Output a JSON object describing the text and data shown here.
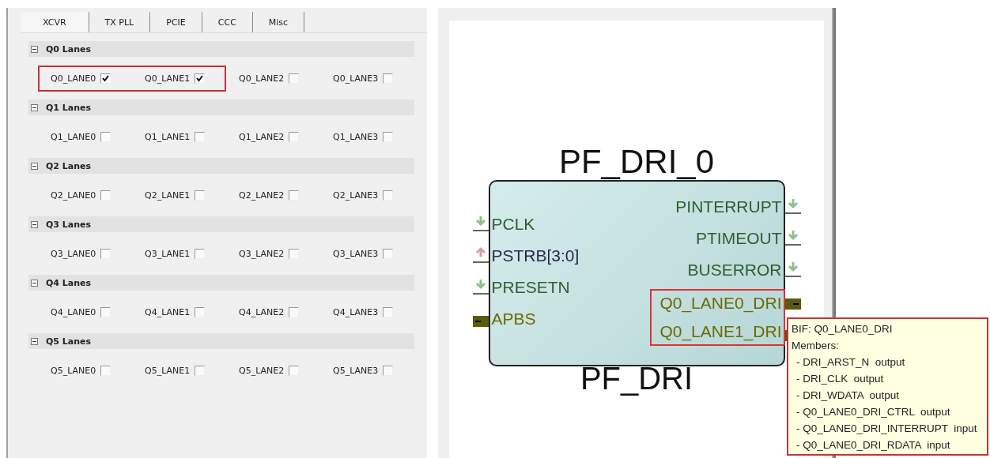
{
  "tabs": [
    {
      "label": "XCVR",
      "selected": true
    },
    {
      "label": "TX PLL",
      "selected": false
    },
    {
      "label": "PCIE",
      "selected": false
    },
    {
      "label": "CCC",
      "selected": false
    },
    {
      "label": "Misc",
      "selected": false
    }
  ],
  "sections": [
    {
      "title": "Q0 Lanes",
      "expanded": true,
      "lanes": [
        {
          "label": "Q0_LANE0",
          "checked": true,
          "highlighted": true
        },
        {
          "label": "Q0_LANE1",
          "checked": true,
          "highlighted": true
        },
        {
          "label": "Q0_LANE2",
          "checked": false,
          "highlighted": false
        },
        {
          "label": "Q0_LANE3",
          "checked": false,
          "highlighted": false
        }
      ]
    },
    {
      "title": "Q1 Lanes",
      "expanded": true,
      "lanes": [
        {
          "label": "Q1_LANE0",
          "checked": false,
          "highlighted": false
        },
        {
          "label": "Q1_LANE1",
          "checked": false,
          "highlighted": false
        },
        {
          "label": "Q1_LANE2",
          "checked": false,
          "highlighted": false
        },
        {
          "label": "Q1_LANE3",
          "checked": false,
          "highlighted": false
        }
      ]
    },
    {
      "title": "Q2 Lanes",
      "expanded": true,
      "lanes": [
        {
          "label": "Q2_LANE0",
          "checked": false,
          "highlighted": false
        },
        {
          "label": "Q2_LANE1",
          "checked": false,
          "highlighted": false
        },
        {
          "label": "Q2_LANE2",
          "checked": false,
          "highlighted": false
        },
        {
          "label": "Q2_LANE3",
          "checked": false,
          "highlighted": false
        }
      ]
    },
    {
      "title": "Q3 Lanes",
      "expanded": true,
      "lanes": [
        {
          "label": "Q3_LANE0",
          "checked": false,
          "highlighted": false
        },
        {
          "label": "Q3_LANE1",
          "checked": false,
          "highlighted": false
        },
        {
          "label": "Q3_LANE2",
          "checked": false,
          "highlighted": false
        },
        {
          "label": "Q3_LANE3",
          "checked": false,
          "highlighted": false
        }
      ]
    },
    {
      "title": "Q4 Lanes",
      "expanded": true,
      "lanes": [
        {
          "label": "Q4_LANE0",
          "checked": false,
          "highlighted": false
        },
        {
          "label": "Q4_LANE1",
          "checked": false,
          "highlighted": false
        },
        {
          "label": "Q4_LANE2",
          "checked": false,
          "highlighted": false
        },
        {
          "label": "Q4_LANE3",
          "checked": false,
          "highlighted": false
        }
      ]
    },
    {
      "title": "Q5 Lanes",
      "expanded": true,
      "lanes": [
        {
          "label": "Q5_LANE0",
          "checked": false,
          "highlighted": false
        },
        {
          "label": "Q5_LANE1",
          "checked": false,
          "highlighted": false
        },
        {
          "label": "Q5_LANE2",
          "checked": false,
          "highlighted": false
        },
        {
          "label": "Q5_LANE3",
          "checked": false,
          "highlighted": false
        }
      ]
    }
  ],
  "block": {
    "instance_name": "PF_DRI_0",
    "type_name": "PF_DRI",
    "left_ports": [
      {
        "name": "PCLK",
        "kind": "input",
        "highlighted": false
      },
      {
        "name": "PSTRB[3:0]",
        "kind": "output",
        "highlighted": false
      },
      {
        "name": "PRESETN",
        "kind": "input",
        "highlighted": false
      },
      {
        "name": "APBS",
        "kind": "bus",
        "highlighted": false
      }
    ],
    "right_ports": [
      {
        "name": "PINTERRUPT",
        "kind": "input",
        "highlighted": false
      },
      {
        "name": "PTIMEOUT",
        "kind": "input",
        "highlighted": false
      },
      {
        "name": "BUSERROR",
        "kind": "input",
        "highlighted": false
      },
      {
        "name": "Q0_LANE0_DRI",
        "kind": "bus",
        "highlighted": true
      },
      {
        "name": "Q0_LANE1_DRI",
        "kind": "bus",
        "highlighted": true
      }
    ]
  },
  "tooltip": {
    "title": "BIF: Q0_LANE0_DRI",
    "members_label": "Members:",
    "members": [
      "- DRI_ARST_N  output",
      "- DRI_CLK  output",
      "- DRI_WDATA  output",
      "- Q0_LANE0_DRI_CTRL  output",
      "- Q0_LANE0_DRI_INTERRUPT  input",
      "- Q0_LANE0_DRI_RDATA  input"
    ]
  }
}
